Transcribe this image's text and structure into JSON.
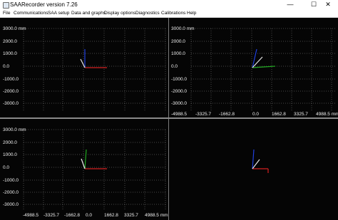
{
  "window": {
    "title": "SAARecorder version 7.26",
    "icon": "app-icon",
    "controls": {
      "minimize": "—",
      "maximize": "☐",
      "close": "✕"
    }
  },
  "menu": [
    "File",
    "Communications",
    "SAA setup",
    "Data and graphs",
    "Display options",
    "Diagnostics",
    "Calibrations",
    "Help"
  ],
  "plots": {
    "y_unit": "mm",
    "y_labels": [
      "3000.0",
      "2000.0",
      "1000.0",
      "0.0",
      "-1000.0",
      "-2000.0",
      "-3000.0"
    ],
    "x_labels": [
      "-4988.5",
      "-3325.7",
      "-1662.8",
      "0.0",
      "1662.8",
      "3325.7",
      "4988.5"
    ],
    "x_unit": "mm",
    "colors": {
      "background": "#050505",
      "grid": "#8a8a8a",
      "axis_x": "#d42020",
      "axis_y": "#22aa22",
      "axis_z": "#2040e0",
      "vector": "#e8e8e8",
      "divider": "#7a7a7a"
    }
  }
}
